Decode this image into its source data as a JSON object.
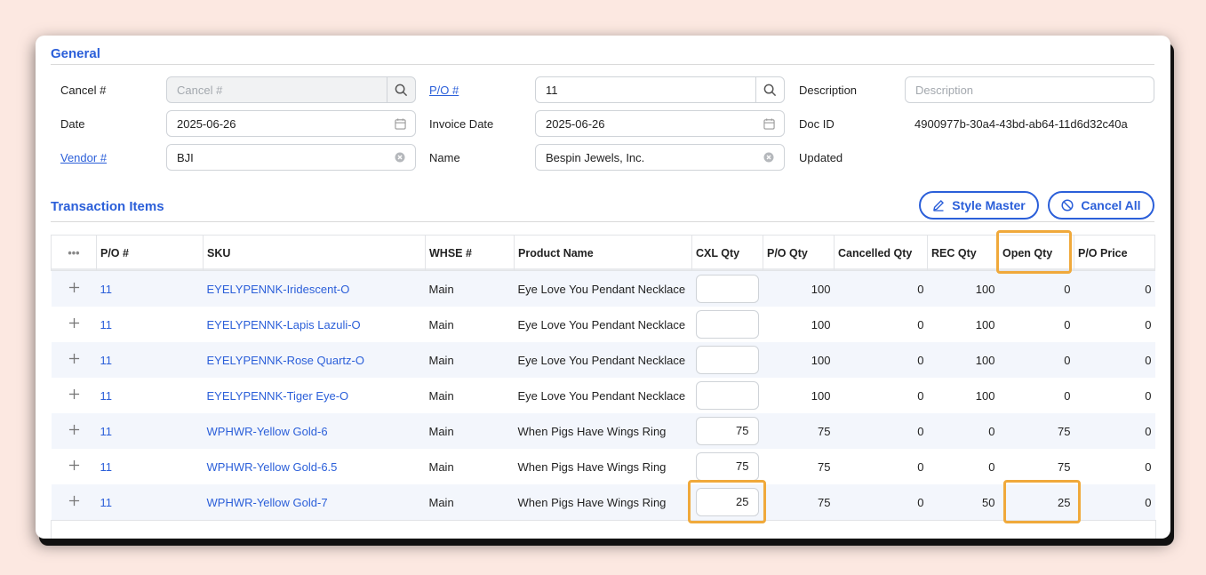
{
  "general": {
    "title": "General",
    "cancel_label": "Cancel #",
    "cancel_placeholder": "Cancel #",
    "po_label": "P/O #",
    "po_value": "11",
    "description_label": "Description",
    "description_placeholder": "Description",
    "date_label": "Date",
    "date_value": "2025-06-26",
    "invoice_date_label": "Invoice Date",
    "invoice_date_value": "2025-06-26",
    "doc_id_label": "Doc ID",
    "doc_id_value": "4900977b-30a4-43bd-ab64-11d6d32c40a",
    "vendor_label": "Vendor #",
    "vendor_value": "BJI",
    "name_label": "Name",
    "name_value": "Bespin Jewels, Inc.",
    "updated_label": "Updated"
  },
  "items": {
    "title": "Transaction Items",
    "style_master_label": "Style Master",
    "cancel_all_label": "Cancel All",
    "columns": [
      "•••",
      "P/O #",
      "SKU",
      "WHSE #",
      "Product Name",
      "CXL Qty",
      "P/O Qty",
      "Cancelled Qty",
      "REC Qty",
      "Open Qty",
      "P/O Price"
    ],
    "rows": [
      {
        "po": "11",
        "sku": "EYELYPENNK-Iridescent-O",
        "whse": "Main",
        "product": "Eye Love You Pendant Necklace",
        "cxl": "",
        "po_qty": "100",
        "cancelled": "0",
        "rec": "100",
        "open": "0",
        "price": "0"
      },
      {
        "po": "11",
        "sku": "EYELYPENNK-Lapis Lazuli-O",
        "whse": "Main",
        "product": "Eye Love You Pendant Necklace",
        "cxl": "",
        "po_qty": "100",
        "cancelled": "0",
        "rec": "100",
        "open": "0",
        "price": "0"
      },
      {
        "po": "11",
        "sku": "EYELYPENNK-Rose Quartz-O",
        "whse": "Main",
        "product": "Eye Love You Pendant Necklace",
        "cxl": "",
        "po_qty": "100",
        "cancelled": "0",
        "rec": "100",
        "open": "0",
        "price": "0"
      },
      {
        "po": "11",
        "sku": "EYELYPENNK-Tiger Eye-O",
        "whse": "Main",
        "product": "Eye Love You Pendant Necklace",
        "cxl": "",
        "po_qty": "100",
        "cancelled": "0",
        "rec": "100",
        "open": "0",
        "price": "0"
      },
      {
        "po": "11",
        "sku": "WPHWR-Yellow Gold-6",
        "whse": "Main",
        "product": "When Pigs Have Wings Ring",
        "cxl": "75",
        "po_qty": "75",
        "cancelled": "0",
        "rec": "0",
        "open": "75",
        "price": "0"
      },
      {
        "po": "11",
        "sku": "WPHWR-Yellow Gold-6.5",
        "whse": "Main",
        "product": "When Pigs Have Wings Ring",
        "cxl": "75",
        "po_qty": "75",
        "cancelled": "0",
        "rec": "0",
        "open": "75",
        "price": "0"
      },
      {
        "po": "11",
        "sku": "WPHWR-Yellow Gold-7",
        "whse": "Main",
        "product": "When Pigs Have Wings Ring",
        "cxl": "25",
        "po_qty": "75",
        "cancelled": "0",
        "rec": "50",
        "open": "25",
        "price": "0"
      }
    ]
  },
  "colors": {
    "accent": "#2b5fd9",
    "highlight": "#f0a93b",
    "background": "#fce8e1"
  }
}
